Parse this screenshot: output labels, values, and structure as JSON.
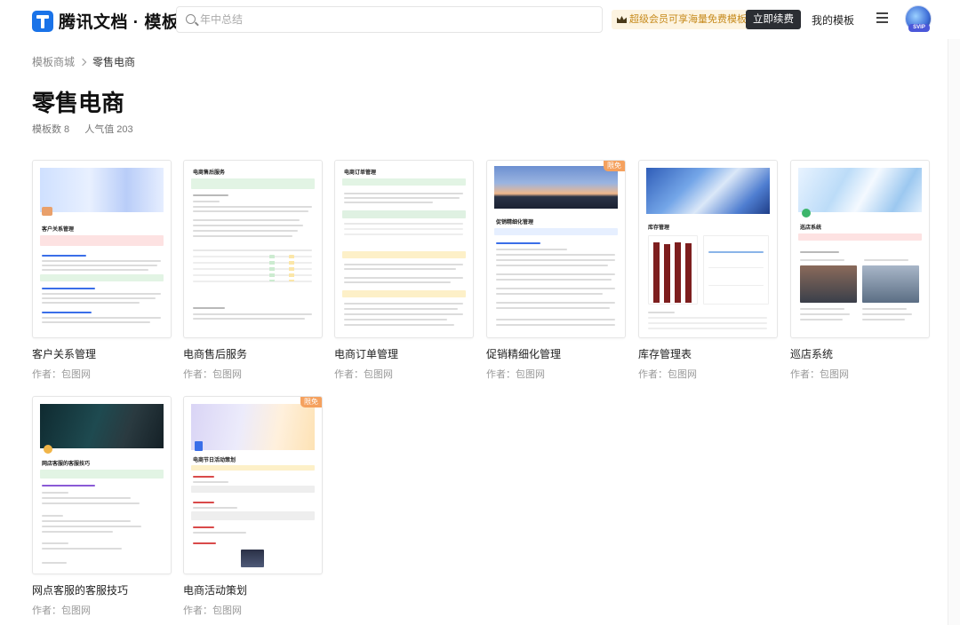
{
  "header": {
    "logo_text": "腾讯文档 · 模板",
    "search_placeholder": "年中总结",
    "vip_text": "超级会员可享海量免费模板",
    "renew_label": "立即续费",
    "my_templates_label": "我的模板",
    "avatar_badge": "SVIP"
  },
  "breadcrumb": {
    "root": "模板商城",
    "current": "零售电商"
  },
  "page": {
    "title": "零售电商",
    "count_label": "模板数 8",
    "popularity_label": "人气值 203"
  },
  "badge_label": "限免",
  "templates": [
    {
      "title": "客户关系管理",
      "author": "作者：包图网",
      "doc_heading": "客户关系管理",
      "badge": false
    },
    {
      "title": "电商售后服务",
      "author": "作者：包图网",
      "doc_heading": "电商售后服务",
      "badge": false
    },
    {
      "title": "电商订单管理",
      "author": "作者：包图网",
      "doc_heading": "电商订单管理",
      "badge": false
    },
    {
      "title": "促销精细化管理",
      "author": "作者：包图网",
      "doc_heading": "促销精细化管理",
      "badge": true
    },
    {
      "title": "库存管理表",
      "author": "作者：包图网",
      "doc_heading": "库存管理",
      "badge": false
    },
    {
      "title": "巡店系统",
      "author": "作者：包图网",
      "doc_heading": "巡店系统",
      "badge": false
    },
    {
      "title": "网点客服的客服技巧",
      "author": "作者：包图网",
      "doc_heading": "网店客服的客服技巧",
      "badge": false
    },
    {
      "title": "电商活动策划",
      "author": "作者：包图网",
      "doc_heading": "电商节日活动策划",
      "badge": true
    }
  ],
  "colors": {
    "accent_dark": "#2b2e33",
    "badge": "#f5a15e",
    "vip_text": "#c68a1c",
    "brand_blue": "#1a73e8"
  }
}
